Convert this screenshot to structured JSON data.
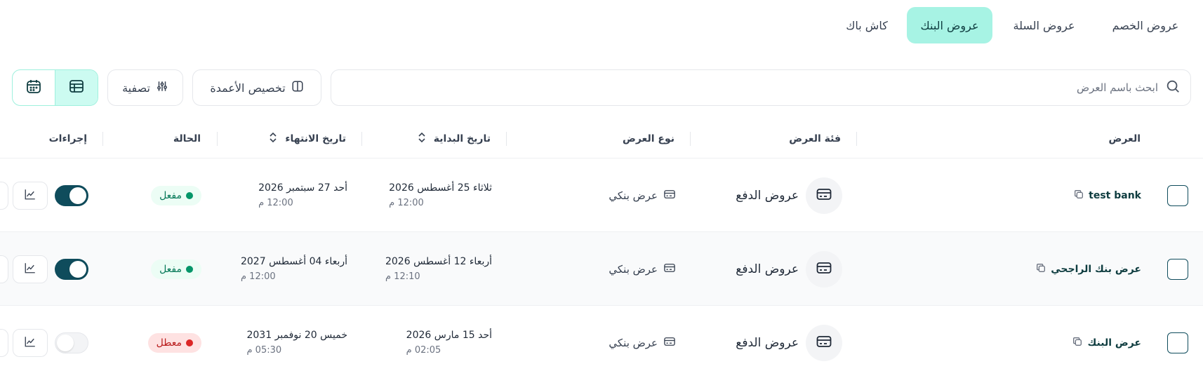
{
  "tabs": [
    {
      "label": "عروض الخصم",
      "active": false
    },
    {
      "label": "عروض السلة",
      "active": false
    },
    {
      "label": "عروض البنك",
      "active": true
    },
    {
      "label": "كاش باك",
      "active": false
    }
  ],
  "toolbar": {
    "search_placeholder": "ابحث باسم العرض",
    "customize_columns_label": "تخصيص الأعمدة",
    "filter_label": "تصفية",
    "view_modes": [
      "table-icon",
      "calendar-icon"
    ]
  },
  "table": {
    "headers": {
      "offer": "العرض",
      "category": "فئة العرض",
      "type": "نوع العرض",
      "start_date": "تاريخ البداية",
      "end_date": "تاريخ الانتهاء",
      "status": "الحالة",
      "actions": "إجراءات"
    },
    "rows": [
      {
        "name": "test bank",
        "category": "عروض الدفع",
        "type": "عرض بنكي",
        "start_date": "ثلاثاء 25 أغسطس 2026",
        "start_time": "12:00 م",
        "end_date": "أحد 27 سبتمبر 2026",
        "end_time": "12:00 م",
        "status": "مفعل",
        "enabled": true
      },
      {
        "name": "عرض بنك الراجحي",
        "category": "عروض الدفع",
        "type": "عرض بنكي",
        "start_date": "أربعاء 12 أغسطس 2026",
        "start_time": "12:10 م",
        "end_date": "أربعاء 04 أغسطس 2027",
        "end_time": "12:00 م",
        "status": "مفعل",
        "enabled": true
      },
      {
        "name": "عرض البنك",
        "category": "عروض الدفع",
        "type": "عرض بنكي",
        "start_date": "أحد 15 مارس 2026",
        "start_time": "02:05 م",
        "end_date": "خميس 20 نوفمبر 2031",
        "end_time": "05:30 م",
        "status": "معطل",
        "enabled": false
      }
    ]
  },
  "colors": {
    "accent": "#a7f3e4",
    "toggle_on": "#0f4c5c",
    "toggle_off": "#e5e7eb",
    "active_badge_bg": "#ecfdf5",
    "active_badge_text": "#047857",
    "active_dot": "#059669",
    "inactive_badge_bg": "#fee2e2",
    "inactive_badge_text": "#b91c1c",
    "inactive_dot": "#dc2626"
  }
}
